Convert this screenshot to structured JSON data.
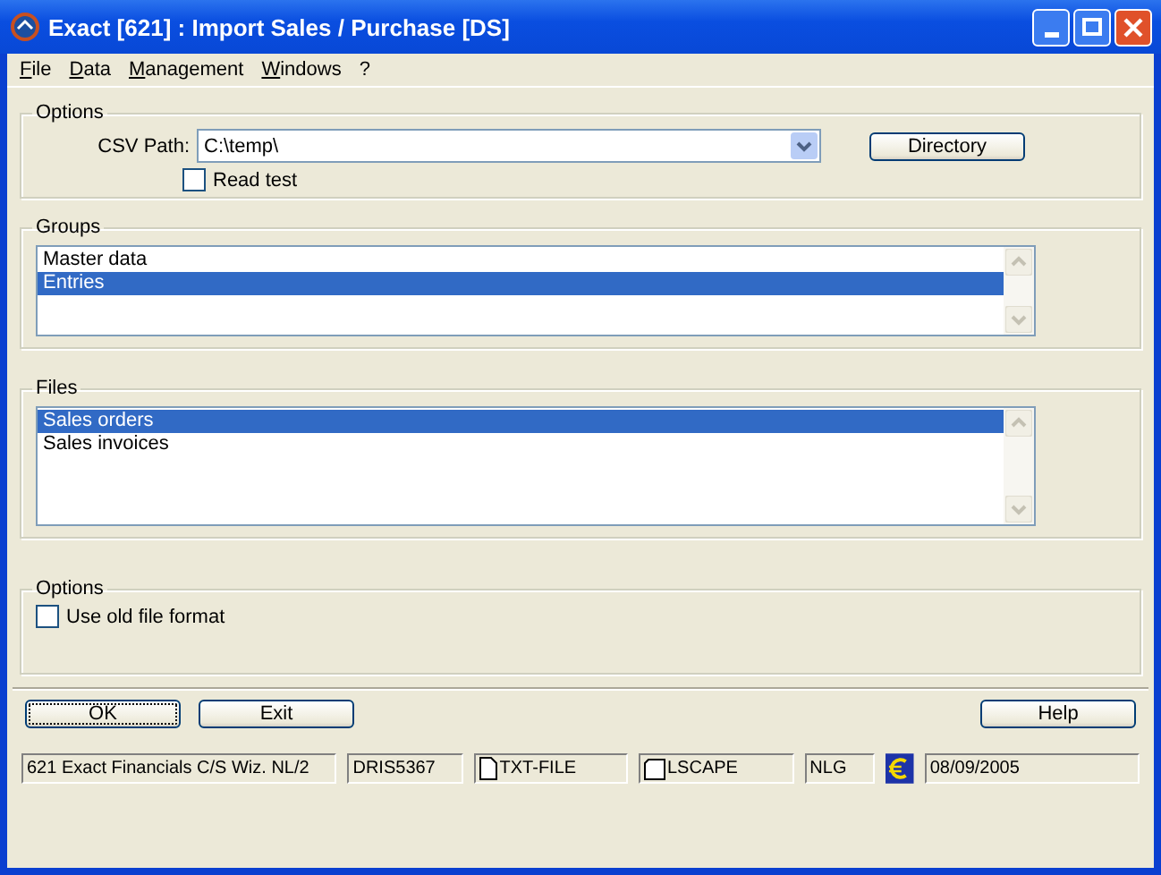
{
  "window": {
    "title": "Exact [621] : Import Sales / Purchase [DS]"
  },
  "menu": [
    "File",
    "Data",
    "Management",
    "Windows",
    "?"
  ],
  "options": {
    "title": "Options",
    "csv_label": "CSV Path:",
    "csv_value": "C:\\temp\\",
    "directory_button": "Directory",
    "read_test": {
      "label": "Read test",
      "checked": false
    }
  },
  "groups": {
    "title": "Groups",
    "items": [
      {
        "label": "Master data",
        "selected": false
      },
      {
        "label": "Entries",
        "selected": true
      }
    ]
  },
  "files": {
    "title": "Files",
    "items": [
      {
        "label": "Sales orders",
        "selected": true
      },
      {
        "label": "Sales invoices",
        "selected": false
      }
    ]
  },
  "options2": {
    "title": "Options",
    "old_format": {
      "label": "Use old file format",
      "checked": false
    }
  },
  "buttons": {
    "ok": "OK",
    "exit": "Exit",
    "help": "Help"
  },
  "status_bar": [
    {
      "kind": "text",
      "text": "621 Exact Financials C/S Wiz. NL/2"
    },
    {
      "kind": "text",
      "text": "DRIS5367"
    },
    {
      "kind": "doc",
      "text": "TXT-FILE"
    },
    {
      "kind": "page",
      "text": "LSCAPE"
    },
    {
      "kind": "text",
      "text": "NLG"
    },
    {
      "kind": "euro"
    },
    {
      "kind": "text",
      "text": "08/09/2005"
    }
  ]
}
